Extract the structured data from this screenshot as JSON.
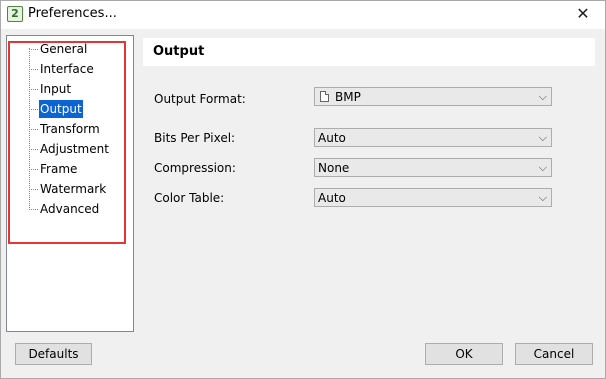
{
  "window": {
    "title": "Preferences...",
    "app_icon_glyph": "2",
    "close_glyph": "✕"
  },
  "sidebar": {
    "items": [
      {
        "label": "General",
        "selected": false
      },
      {
        "label": "Interface",
        "selected": false
      },
      {
        "label": "Input",
        "selected": false
      },
      {
        "label": "Output",
        "selected": true
      },
      {
        "label": "Transform",
        "selected": false
      },
      {
        "label": "Adjustment",
        "selected": false
      },
      {
        "label": "Frame",
        "selected": false
      },
      {
        "label": "Watermark",
        "selected": false
      },
      {
        "label": "Advanced",
        "selected": false
      }
    ],
    "selected_color": "#0a64d2",
    "highlight_color": "#e53535"
  },
  "content": {
    "title": "Output",
    "output_format": {
      "label": "Output Format:",
      "value": "BMP",
      "icon": "file-icon"
    },
    "bits_per_pixel": {
      "label": "Bits Per Pixel:",
      "value": "Auto"
    },
    "compression": {
      "label": "Compression:",
      "value": "None"
    },
    "color_table": {
      "label": "Color Table:",
      "value": "Auto"
    }
  },
  "dropdown_icon": "chevron-down-icon",
  "chevron_glyph": "⌵",
  "buttons": {
    "defaults": "Defaults",
    "ok": "OK",
    "cancel": "Cancel"
  }
}
